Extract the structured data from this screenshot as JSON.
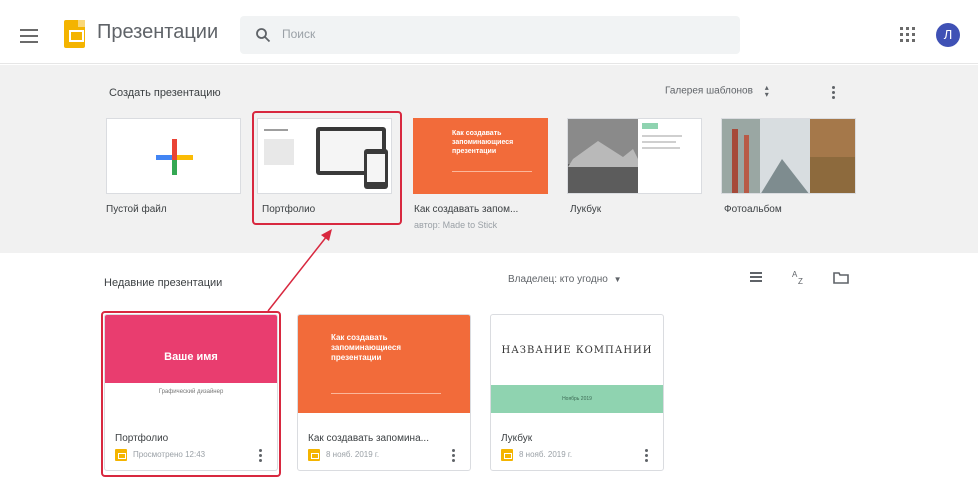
{
  "header": {
    "app_title": "Презентации",
    "search_placeholder": "Поиск",
    "avatar_letter": "Л"
  },
  "templates": {
    "section_title": "Создать презентацию",
    "gallery_label": "Галерея шаблонов",
    "items": [
      {
        "label": "Пустой файл",
        "sub": ""
      },
      {
        "label": "Портфолио",
        "sub": ""
      },
      {
        "label": "Как создавать запом...",
        "sub": "автор: Made to Stick"
      },
      {
        "label": "Лукбук",
        "sub": ""
      },
      {
        "label": "Фотоальбом",
        "sub": ""
      }
    ],
    "thumb_text": {
      "made_to_stick": "Как создавать запоминающиеся презентации"
    }
  },
  "recent": {
    "section_title": "Недавние презентации",
    "owner_filter": "Владелец: кто угодно",
    "docs": [
      {
        "name": "Портфолио",
        "date": "Просмотрено 12:43",
        "thumb_title": "Ваше имя",
        "thumb_sub": "Графический дизайнер"
      },
      {
        "name": "Как создавать запомина...",
        "date": "8 нояб. 2019 г.",
        "thumb_title": "Как создавать запоминающиеся презентации"
      },
      {
        "name": "Лукбук",
        "date": "8 нояб. 2019 г.",
        "thumb_title": "НАЗВАНИЕ КОМПАНИИ",
        "thumb_sub": "Ноябрь 2019"
      }
    ]
  },
  "colors": {
    "accent_red": "#d8283f",
    "slides_yellow": "#f4b400",
    "orange": "#f26b3a",
    "pink": "#e93d6f",
    "mint": "#8fd3b0",
    "avatar": "#3f51b5"
  },
  "icons": [
    "menu-icon",
    "slides-logo-icon",
    "search-icon",
    "apps-grid-icon",
    "sort-arrows-icon",
    "more-vert-icon",
    "list-view-icon",
    "sort-az-icon",
    "folder-icon"
  ]
}
